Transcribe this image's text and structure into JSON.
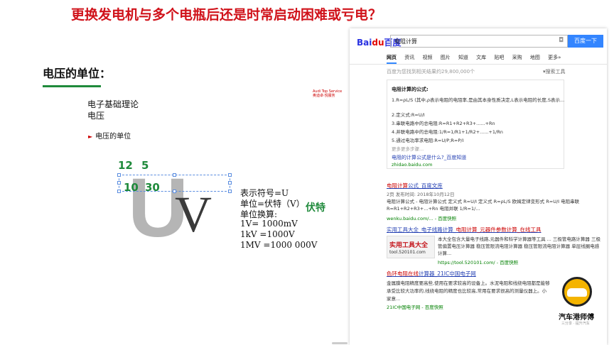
{
  "slide": {
    "headline": "更换发电机与多个电瓶后还是时常启动困难或亏电？",
    "voltage_title": "电压的单位：",
    "audi_logo_text_1": "Audi Top Service",
    "audi_logo_text_2": "奥迪卓·悦服务",
    "sub_line_1": "电子基础理论",
    "sub_line_2": "电压",
    "bullet_text": "电压的单位",
    "green_numbers": [
      "12",
      "5",
      "10",
      "30"
    ],
    "big_letters": [
      "U",
      "V"
    ],
    "definitions": [
      "表示符号=U",
      "单位=伏特（V）",
      "单位换算:",
      "1V= 1000mV",
      "1kV =1000V",
      "1MV =1000 000V"
    ],
    "volt_label": "伏特"
  },
  "browser": {
    "logo_blue": "Bai",
    "logo_red": "du",
    "logo_cn": "百度",
    "search_value": "电阻计算",
    "search_button": "百度一下",
    "tabs": [
      "网页",
      "资讯",
      "视频",
      "图片",
      "知道",
      "文库",
      "贴吧",
      "采购",
      "地图",
      "更多»"
    ],
    "result_count": "百度为您找到相关结果约29,800,000个",
    "tools_label": "搜索工具",
    "answer": {
      "title": "电阻计算的公式:",
      "lines": [
        "1.R=ρL/S (其中,ρ表示电阻的电阻率,是由其本身性质决定,L表示电阻的长度,S表示...",
        "2.定义式:R=U/I",
        "3.串联电路中的总电阻:R=R1+R2+R3+......+Rn",
        "4.并联电路中的总电阻:1/R=1/R1+1/R2+......+1/Rn",
        "5.通过电功率求电阻:R=U/P;R=P/I"
      ],
      "more": "更多更多步骤...",
      "link": "电阻的计算公式是什么?_百度知道",
      "url": "zhidao.baidu.com"
    },
    "results": [
      {
        "title_pre": "电阻计算",
        "title_post": "公式_百度文库",
        "meta": "2页 发布时间: 2018年10月12日",
        "text": "电阻计算公式 - 电阻计算公式 定义式 R=U/I 定义式 R=ρL/S 欧姆定律变形式 R=U/I 电阻串联 R=R1+R2+R3+...+Rn 电阻并联 1/R=1/...",
        "url": "wenku.baidu.com/... - 百度快照"
      },
      {
        "title_pre": "实用工具大全_电子线路计算_",
        "title_post": "电阻计算_元器件参数计算_在线工具",
        "thumb_title": "实用工具大全",
        "thumb_url": "tool.520101.com",
        "text_1": "本大全包含大量电子线路,元器件和科学计算器等工具 ... 三极管电路计算器 三极管偏置电压计算器 稳压管限流电",
        "text_2": "阻计算器 稳压管限流电阻计算器 单层线圈电感计算...",
        "url": "https://tool.520101.com/ - 百度快照"
      },
      {
        "title_pre": "色环电阻在线",
        "title_post": "计算器_21IC中国电子网",
        "text_1": "金属膜电阻精度要高些,使用在要求较高的设备上。水泥电阻和线绕电阻都是能够",
        "text_2": "承受比较大功率的,线绕电阻的精度也比较高,常用在要求很高的测量仪器上。小",
        "text_3": "家意...",
        "url": "21IC中国电子网 - 百度快照"
      }
    ]
  },
  "brand": {
    "name": "汽车港师傅",
    "subtitle": "三分享 · 提升汽车"
  },
  "colors": {
    "headline_red": "#d0121a",
    "accent_green": "#1f8a3b",
    "baidu_blue": "#3385ff",
    "link_blue": "#2440b3"
  }
}
